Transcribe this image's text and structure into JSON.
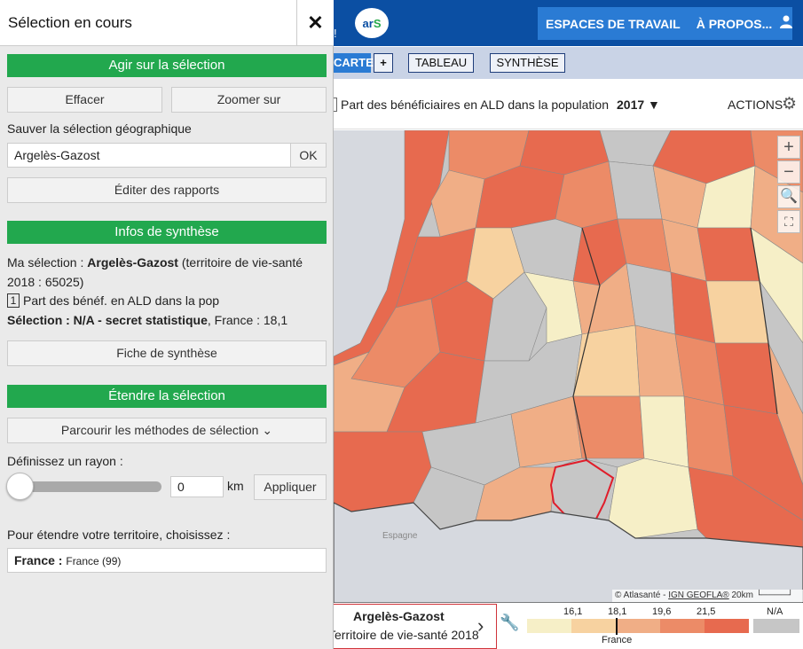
{
  "header": {
    "logo_left": "ar",
    "logo_right": "S",
    "exclamation": "!",
    "nav": [
      "ESPACES DE TRAVAIL",
      "À PROPOS..."
    ],
    "user_icon": "user-icon"
  },
  "viewbar": {
    "carte_label": "CARTE",
    "add_label": "+",
    "tableau_label": "TABLEAU",
    "synthese_label": "SYNTHÈSE"
  },
  "indicator": {
    "title": "Part des bénéficiaires en ALD dans la population",
    "year": "2017",
    "actions_label": "ACTIONS"
  },
  "map": {
    "zoom_in": "+",
    "zoom_out": "−",
    "espagne_label": "Espagne",
    "attribution": "© Atlasanté - ",
    "attribution_link": "IGN GEOFLA®",
    "scale_label": "20km"
  },
  "legend": {
    "selection_name": "Argelès-Gazost",
    "selection_type": "Territoire de vie-santé 2018",
    "ticks": [
      "16,1",
      "18,1",
      "19,6",
      "21,5"
    ],
    "na_label": "N/A",
    "france_label": "France",
    "colors": [
      "#f6efc7",
      "#f7d2a0",
      "#f0ae86",
      "#ec8b67",
      "#e76a4f"
    ],
    "na_color": "#c6c6c6"
  },
  "panel": {
    "title": "Sélection en cours",
    "close_label": "✕",
    "act_header": "Agir sur la sélection",
    "effacer_label": "Effacer",
    "zoomer_label": "Zoomer sur",
    "save_label": "Sauver la sélection géographique",
    "save_input_value": "Argelès-Gazost",
    "ok_label": "OK",
    "rapports_label": "Éditer des rapports",
    "infos_header": "Infos de synthèse",
    "ma_selection_prefix": "Ma sélection : ",
    "ma_selection_name": "Argelès-Gazost",
    "ma_selection_suffix": " (territoire de vie-santé",
    "ma_selection_line2": "2018 : 65025)",
    "indicator_number": "1",
    "indicator_text": "Part des bénéf. en ALD dans la pop",
    "selection_value_bold": "Sélection : N/A - secret statistique",
    "selection_value_rest": ", France : 18,1",
    "fiche_label": "Fiche de synthèse",
    "etendre_header": "Étendre la sélection",
    "parcourir_label": "Parcourir les méthodes de sélection",
    "rayon_label": "Définissez un rayon :",
    "rayon_value": "0",
    "km_label": "km",
    "appliquer_label": "Appliquer",
    "etendre_text": "Pour étendre votre territoire, choisissez :",
    "territory_bold": "France :",
    "territory_rest": "France (99)"
  }
}
